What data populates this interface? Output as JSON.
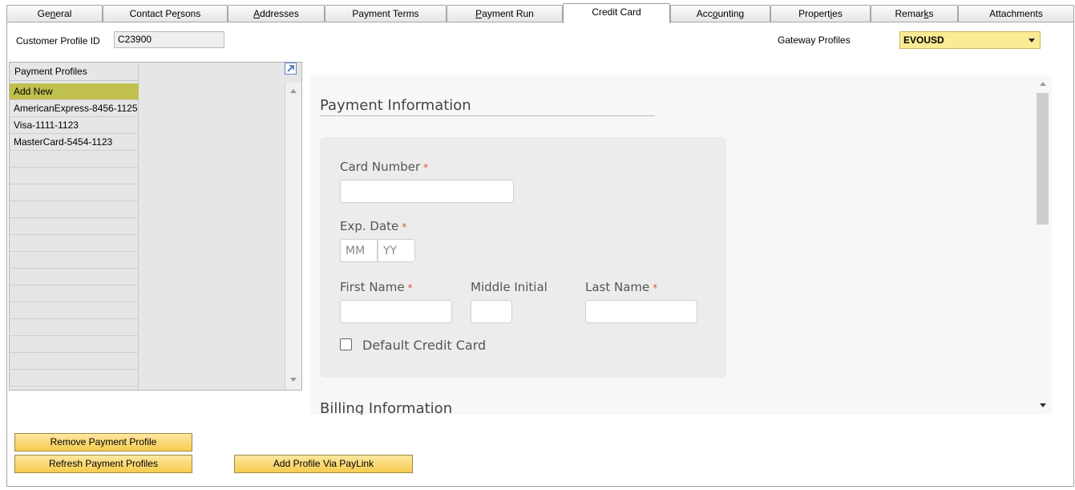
{
  "tabs": [
    {
      "pre": "Ge",
      "key": "n",
      "post": "eral"
    },
    {
      "pre": "Contact Pe",
      "key": "r",
      "post": "sons"
    },
    {
      "pre": "",
      "key": "A",
      "post": "ddresses"
    },
    {
      "pre": "Payment Terms",
      "key": "",
      "post": ""
    },
    {
      "pre": "",
      "key": "P",
      "post": "ayment Run"
    },
    {
      "pre": "Credit Card",
      "key": "",
      "post": ""
    },
    {
      "pre": "Acc",
      "key": "o",
      "post": "unting"
    },
    {
      "pre": "Propert",
      "key": "i",
      "post": "es"
    },
    {
      "pre": "Remar",
      "key": "k",
      "post": "s"
    },
    {
      "pre": "Attachments",
      "key": "",
      "post": ""
    }
  ],
  "header": {
    "customer_profile_label": "Customer Profile ID",
    "customer_profile_value": "C23900",
    "gateway_label": "Gateway Profiles",
    "gateway_value": "EVOUSD"
  },
  "profiles": {
    "header": "Payment Profiles",
    "items": [
      "Add New",
      "AmericanExpress-8456-1125",
      "Visa-1111-1123",
      "MasterCard-5454-1123"
    ]
  },
  "payment": {
    "title": "Payment Information",
    "card_number_label": "Card Number",
    "required_mark": "*",
    "exp_label": "Exp. Date",
    "mm_placeholder": "MM",
    "yy_placeholder": "YY",
    "first_name_label": "First Name",
    "middle_initial_label": "Middle Initial",
    "last_name_label": "Last Name",
    "default_card_label": "Default Credit Card"
  },
  "billing": {
    "title": "Billing Information"
  },
  "buttons": {
    "remove": "Remove Payment Profile",
    "refresh": "Refresh Payment Profiles",
    "paylink": "Add Profile Via PayLink"
  }
}
